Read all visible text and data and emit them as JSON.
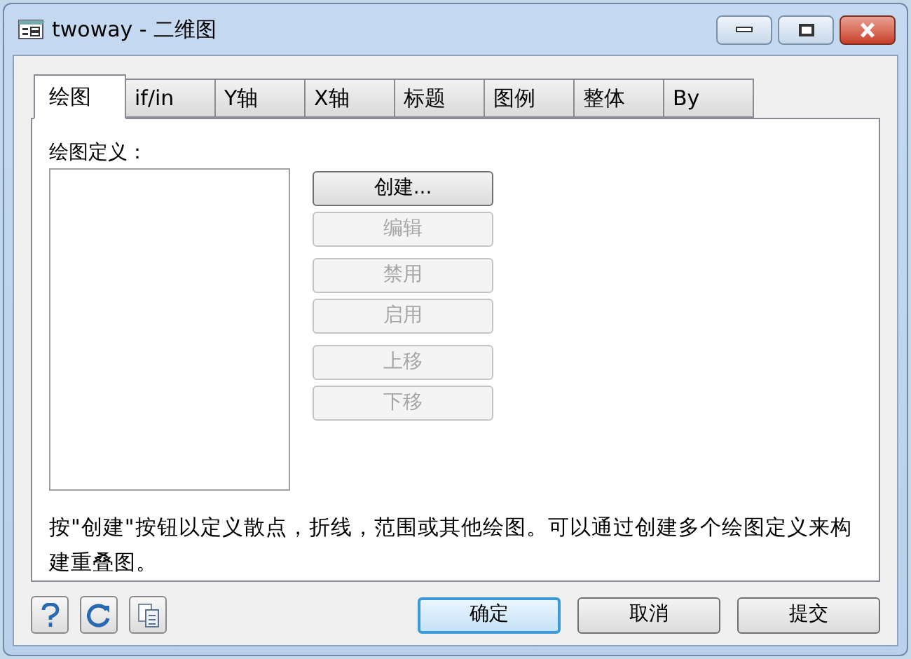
{
  "window": {
    "title": "twoway - 二维图"
  },
  "tabs": [
    {
      "label": "绘图",
      "selected": true
    },
    {
      "label": "if/in",
      "selected": false
    },
    {
      "label": "Y轴",
      "selected": false
    },
    {
      "label": "X轴",
      "selected": false
    },
    {
      "label": "标题",
      "selected": false
    },
    {
      "label": "图例",
      "selected": false
    },
    {
      "label": "整体",
      "selected": false
    },
    {
      "label": "By",
      "selected": false
    }
  ],
  "list_label": "绘图定义：",
  "button_groups": [
    [
      {
        "label": "创建...",
        "disabled": false
      },
      {
        "label": "编辑",
        "disabled": true
      }
    ],
    [
      {
        "label": "禁用",
        "disabled": true
      },
      {
        "label": "启用",
        "disabled": true
      }
    ],
    [
      {
        "label": "上移",
        "disabled": true
      },
      {
        "label": "下移",
        "disabled": true
      }
    ]
  ],
  "description": "按\"创建\"按钮以定义散点，折线，范围或其他绘图。可以通过创建多个绘图定义来构建重叠图。",
  "footer_buttons": [
    {
      "label": "确定",
      "default": true
    },
    {
      "label": "取消",
      "default": false
    },
    {
      "label": "提交",
      "default": false
    }
  ]
}
